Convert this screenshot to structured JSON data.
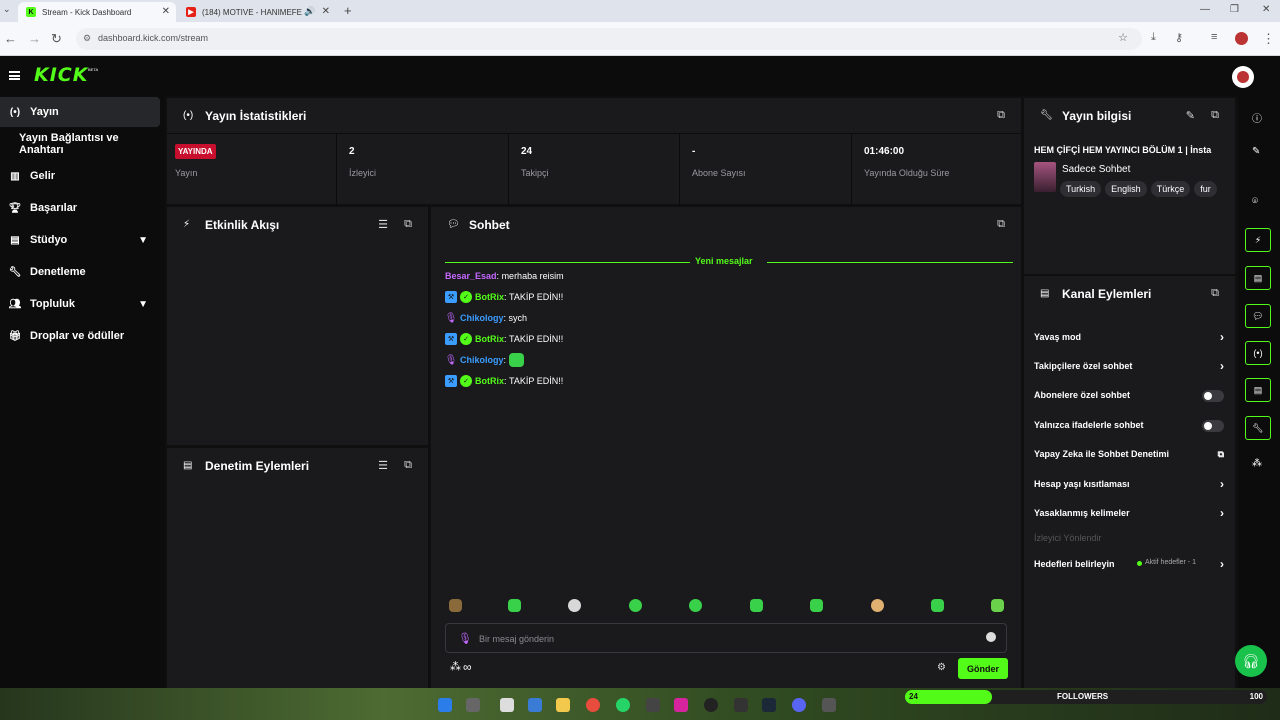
{
  "browser": {
    "tabs": [
      {
        "title": "Stream - Kick Dashboard",
        "active": true
      },
      {
        "title": "(184) MOTIVE - HANIMEFE",
        "active": false
      }
    ],
    "new_tab": "+",
    "url": "dashboard.kick.com/stream"
  },
  "brand": {
    "logo": "KICK",
    "beta": "BETA",
    "accent": "#53fc18"
  },
  "sidebar": {
    "items": [
      {
        "label": "Yayın",
        "icon": "broadcast-icon"
      },
      {
        "label": "Yayın Bağlantısı ve Anahtarı",
        "icon": ""
      },
      {
        "label": "Gelir",
        "icon": "revenue-icon"
      },
      {
        "label": "Başarılar",
        "icon": "trophy-icon"
      },
      {
        "label": "Stüdyo",
        "icon": "studio-icon"
      },
      {
        "label": "Denetleme",
        "icon": "wrench-icon"
      },
      {
        "label": "Topluluk",
        "icon": "community-icon"
      },
      {
        "label": "Droplar ve ödüller",
        "icon": "gift-icon"
      }
    ]
  },
  "stats": {
    "title": "Yayın İstatistikleri",
    "live_badge": "YAYINDA",
    "live_label": "Yayın",
    "items": [
      {
        "value": "2",
        "label": "İzleyici"
      },
      {
        "value": "24",
        "label": "Takipçi"
      },
      {
        "value": "-",
        "label": "Abone Sayısı"
      },
      {
        "value": "01:46:00",
        "label": "Yayında Olduğu Süre"
      }
    ]
  },
  "activity": {
    "title": "Etkinlik Akışı"
  },
  "moderation": {
    "title": "Denetim Eylemleri"
  },
  "chat": {
    "title": "Sohbet",
    "new_messages": "Yeni mesajlar",
    "messages": [
      {
        "user": "Besar_Esad",
        "text": "merhaba reisim",
        "color": "#c468ff"
      },
      {
        "user": "BotRix",
        "text": "TAKİP EDİN!!",
        "color": "#53fc18"
      },
      {
        "user": "Chikology",
        "text": "sych",
        "color": "#3b9dff"
      },
      {
        "user": "BotRix",
        "text": "TAKİP EDİN!!",
        "color": "#53fc18"
      },
      {
        "user": "Chikology",
        "text": "",
        "color": "#3b9dff"
      },
      {
        "user": "BotRix",
        "text": "TAKİP EDİN!!",
        "color": "#53fc18"
      }
    ],
    "input_placeholder": "Bir mesaj gönderin",
    "send_label": "Gönder",
    "footer_left": "∞"
  },
  "stream_info": {
    "title": "Yayın bilgisi",
    "stream_title": "HEM ÇİFÇİ HEM YAYINCI BÖLÜM 1 | İnsta",
    "category": "Sadece Sohbet",
    "languages": [
      "Turkish",
      "English",
      "Türkçe",
      "fur"
    ]
  },
  "channel_actions": {
    "title": "Kanal Eylemleri",
    "items": [
      {
        "label": "Yavaş mod",
        "control": "chevron"
      },
      {
        "label": "Takipçilere özel sohbet",
        "control": "chevron"
      },
      {
        "label": "Abonelere özel sohbet",
        "control": "toggle"
      },
      {
        "label": "Yalnızca ifadelerle sohbet",
        "control": "toggle"
      },
      {
        "label": "Yapay Zeka ile Sohbet Denetimi",
        "control": "external"
      },
      {
        "label": "Hesap yaşı kısıtlaması",
        "control": "chevron"
      },
      {
        "label": "Yasaklanmış kelimeler",
        "control": "chevron"
      },
      {
        "label": "İzleyici Yönlendir",
        "control": "disabled"
      },
      {
        "label": "Hedefleri belirleyin",
        "control": "chevron"
      }
    ],
    "goals_status": "Aktif hedefler - 1"
  },
  "followers_goal": {
    "current": "24",
    "label": "FOLLOWERS",
    "goal": "100",
    "progress": 0.24
  }
}
